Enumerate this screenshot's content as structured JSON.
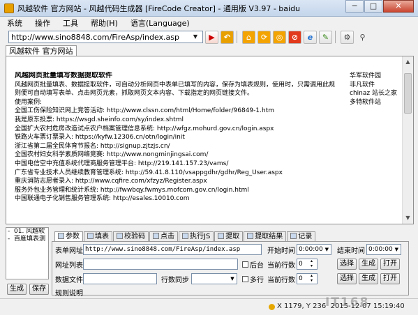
{
  "window": {
    "title": "风越软件 官方网站 - 风越代码生成器 [FireCode Creator] - 通用版 V3.97 - baidu",
    "minimize": "─",
    "maximize": "□",
    "close": "✕"
  },
  "menu": [
    "系统",
    "操作",
    "工具",
    "帮助(H)",
    "语言(Language)"
  ],
  "toolbar": {
    "url": "http://www.sino8848.com/FireAsp/index.asp",
    "buttons": [
      {
        "name": "go-icon",
        "glyph": "▶"
      },
      {
        "name": "back-icon",
        "glyph": "↶"
      },
      {
        "name": "home-icon",
        "glyph": "⌂"
      },
      {
        "name": "refresh-icon",
        "glyph": "⟳"
      },
      {
        "name": "globe-icon",
        "glyph": "◎"
      },
      {
        "name": "stop-icon",
        "glyph": "⊘"
      },
      {
        "name": "ie-icon",
        "glyph": "e"
      },
      {
        "name": "edit-icon",
        "glyph": "✎"
      },
      {
        "name": "settings-icon",
        "glyph": "⚙"
      },
      {
        "name": "search-icon",
        "glyph": "⚲"
      }
    ]
  },
  "browser_tab": "风越软件 官方网站",
  "page": {
    "heading": "风越网页批量填写数据提取软件",
    "intro": [
      "风越网页批量填表、数据提取软件，可自动分析网页中表单已填写的内容，保存为填表规则，使用时，只需调用此规",
      "则便可自动填写表单、点击网页元素，抓取网页文本内容、下载指定的网页链接文件。"
    ],
    "cases_title": "使用案例:",
    "cases": [
      "全国工伤保险知识网上竞答活动: http://www.clssn.com/html/Home/folder/96849-1.htm",
      "我是原东投票: https://wsgd.sheinfo.com/sy/index.shtml",
      "全国扩大农村危房改造试点农户档案管理信息系统: http://wfgz.mohurd.gov.cn/login.aspx",
      "铁路火车票订票录入: https://kyfw.12306.cn/otn/login/init",
      "浙江省第二届全民体育节报名: http://signup.zjtzjs.cn/",
      "全国农村妇女科学素质网络竞赛: http://www.nongminjingsai.com/",
      "中国电信空中充值系统代理商服务管理平台: http://219.141.157.23/vams/",
      "广东省专业技术人员继续教育管理系统: http://59.41.8.110/vsappgdhr/gdhr/Reg_User.aspx",
      "重庆消防志愿者录入: http://www.cqfire.com/xfzyz/Register.aspx",
      "服务外包业务管理和统计系统: http://fwwbqy.fwmys.mofcom.gov.cn/login.html",
      "中国联通电子化销售服务管理系统: http://esales.10010.com"
    ],
    "side_links": [
      "华军软件园",
      "非凡软件",
      "chinaz 站长之家",
      "多特软件站"
    ]
  },
  "tree": [
    "01. 风越软",
    "百度填表测"
  ],
  "left_buttons": {
    "generate": "生成",
    "save": "保存"
  },
  "param_tabs": [
    "参数",
    "填表",
    "校验码",
    "点击",
    "执行JS",
    "提取",
    "提取结果",
    "记录"
  ],
  "params": {
    "form_url_label": "表单网址",
    "form_url": "http://www.sino8848.com/FireAsp/index.asp",
    "start_time_label": "开始时间",
    "start_time": "0:00:00",
    "end_time_label": "结束时间",
    "end_time": "0:00:00",
    "url_list_label": "网址列表",
    "background_label": "后台",
    "current_rows_label": "当前行数",
    "current_rows": "0",
    "data_file_label": "数据文件",
    "rows_sync_label": "行数同步",
    "multi_row_label": "多行",
    "current_rows_label2": "当前行数",
    "current_rows2": "0",
    "rule_desc_label": "规则说明",
    "select": "选择",
    "generate": "生成",
    "open": "打开"
  },
  "status": {
    "coords": "X 1179, Y 236",
    "datetime": "2015-12-07 15:19:40"
  },
  "watermark": "IT168"
}
